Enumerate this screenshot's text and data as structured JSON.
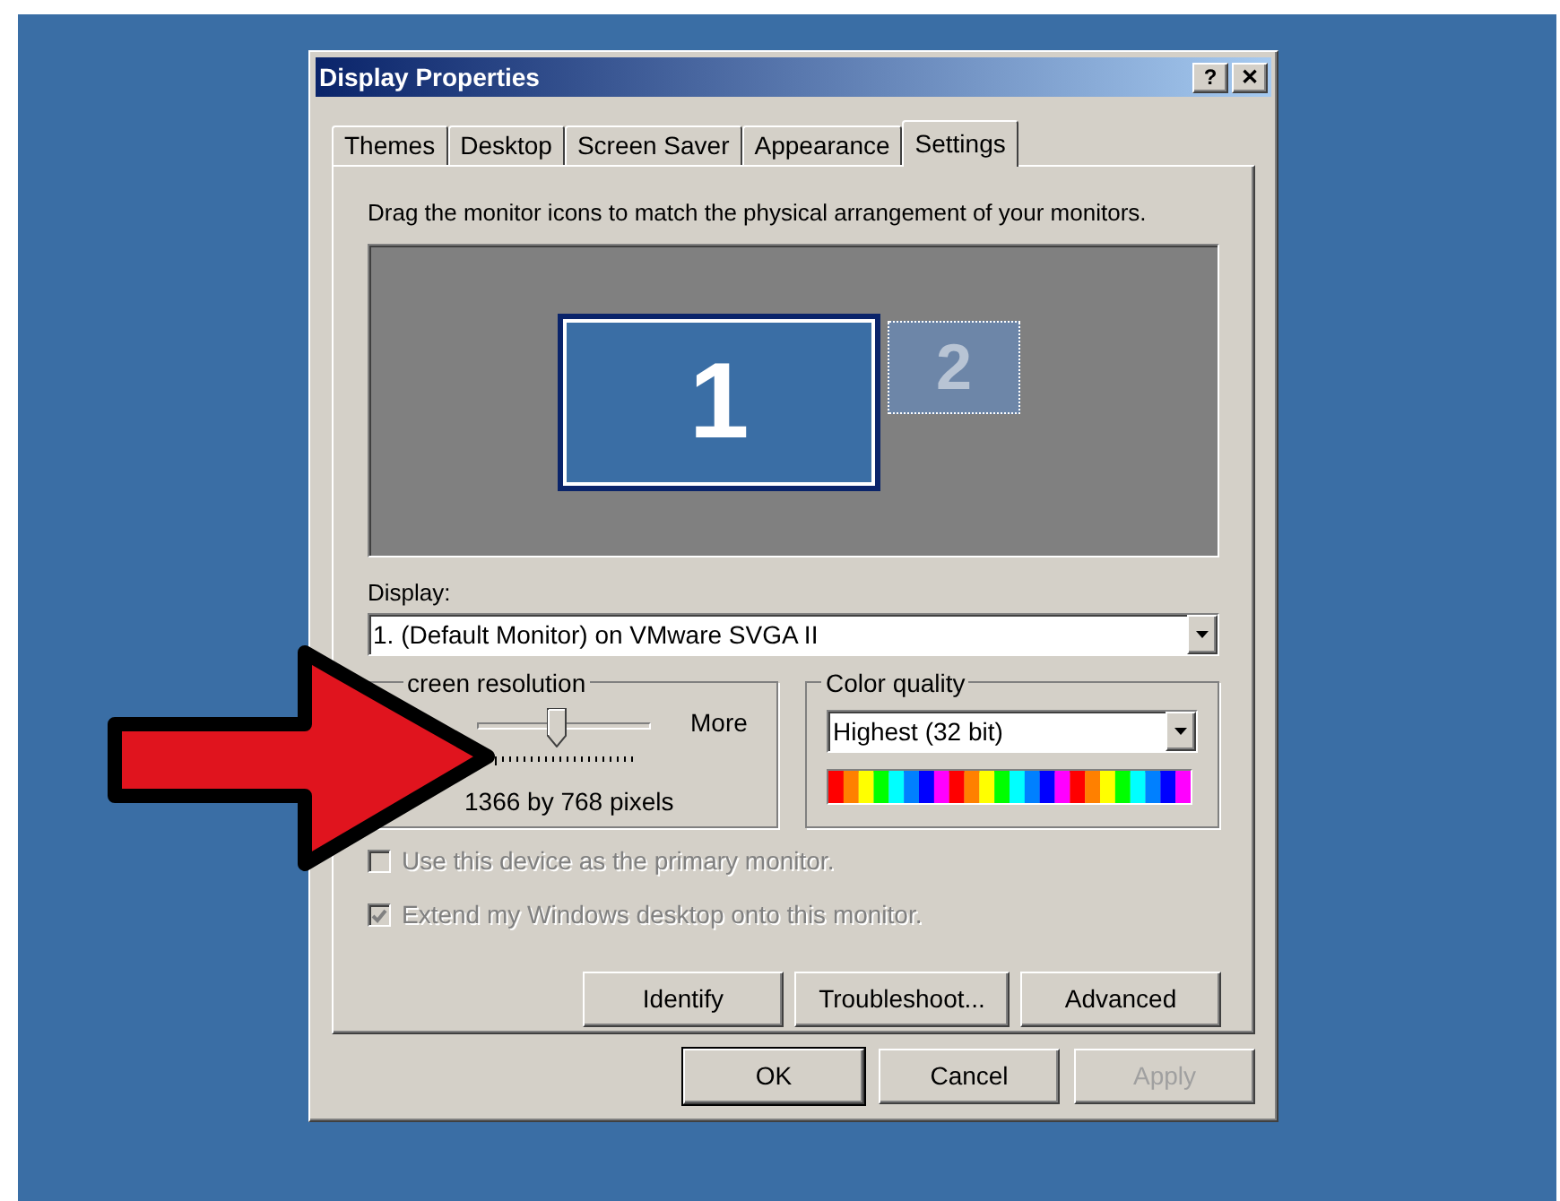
{
  "window": {
    "title": "Display Properties",
    "help_button": "?",
    "close_button": "✕"
  },
  "tabs": [
    {
      "label": "Themes",
      "selected": false
    },
    {
      "label": "Desktop",
      "selected": false
    },
    {
      "label": "Screen Saver",
      "selected": false
    },
    {
      "label": "Appearance",
      "selected": false
    },
    {
      "label": "Settings",
      "selected": true
    }
  ],
  "instructions": "Drag the monitor icons to match the physical arrangement of your monitors.",
  "monitors": [
    {
      "label": "1",
      "selected": true
    },
    {
      "label": "2",
      "selected": false
    }
  ],
  "display": {
    "label": "Display:",
    "value": "1. (Default Monitor) on VMware SVGA II"
  },
  "screen_resolution": {
    "title": "creen resolution",
    "max_label": "More",
    "level": 0.45,
    "reading": "1366 by 768 pixels"
  },
  "color_quality": {
    "title": "Color quality",
    "value": "Highest (32 bit)"
  },
  "checkboxes": [
    {
      "label": "Use this device as the primary monitor.",
      "checked": false,
      "disabled": true
    },
    {
      "label": "Extend my Windows desktop onto this monitor.",
      "checked": true,
      "disabled": true
    }
  ],
  "panel_buttons": [
    "Identify",
    "Troubleshoot...",
    "Advanced"
  ],
  "dialog_buttons": [
    {
      "label": "OK",
      "default": true,
      "disabled": false
    },
    {
      "label": "Cancel",
      "default": false,
      "disabled": false
    },
    {
      "label": "Apply",
      "default": false,
      "disabled": true
    }
  ]
}
